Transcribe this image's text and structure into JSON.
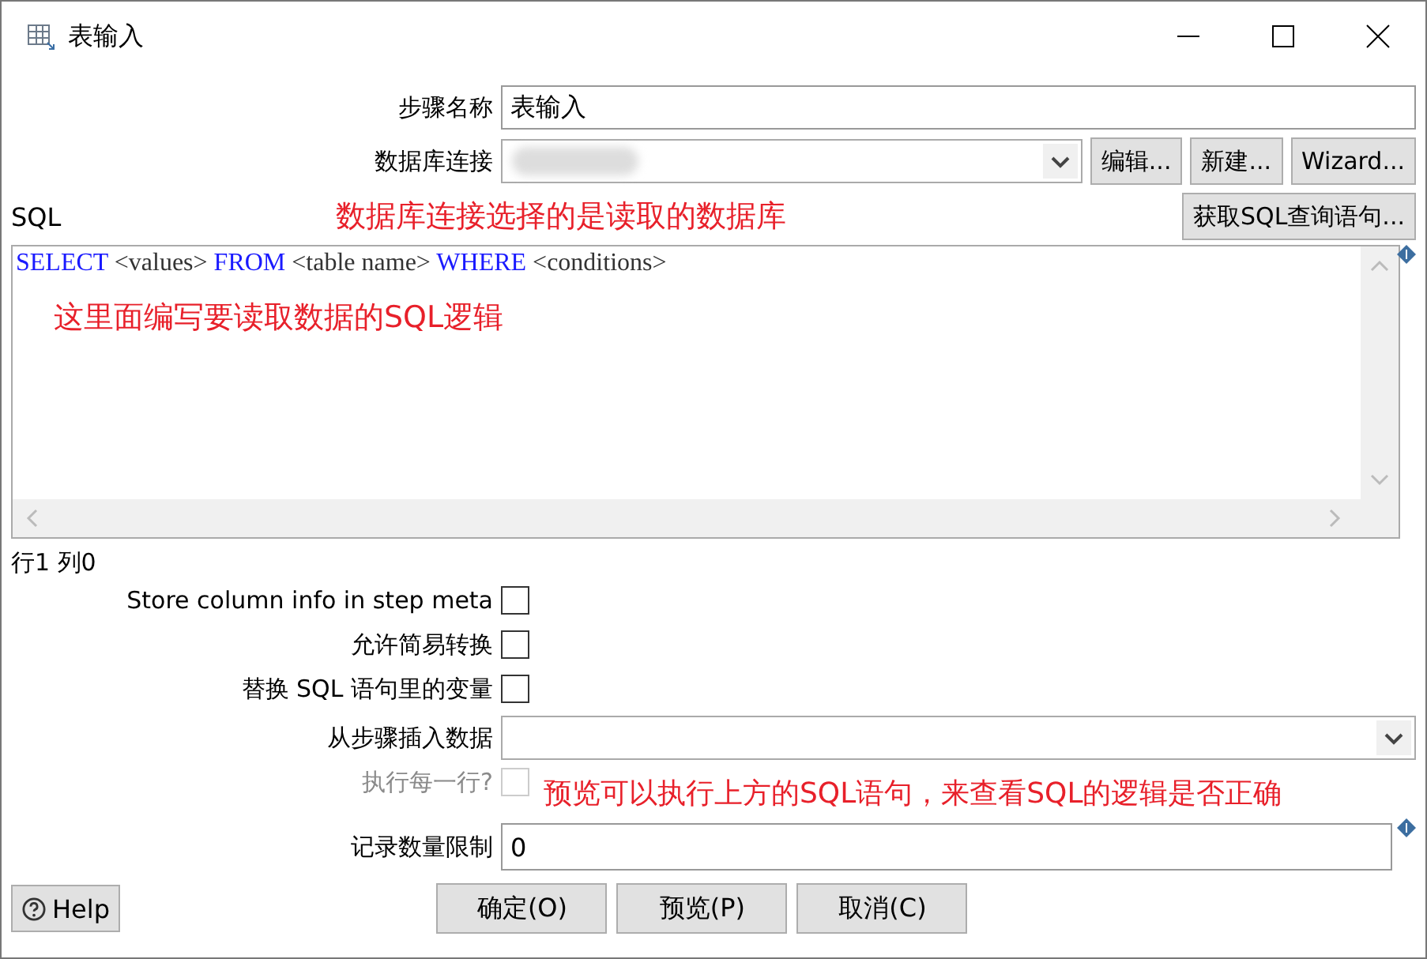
{
  "window": {
    "title": "表输入"
  },
  "step_name": {
    "label": "步骤名称",
    "value": "表输入"
  },
  "connection": {
    "label": "数据库连接",
    "buttons": [
      "编辑...",
      "新建...",
      "Wizard..."
    ]
  },
  "sql_label": "SQL",
  "get_sql_button": "获取SQL查询语句...",
  "sql_tokens": [
    {
      "kind": "keyword",
      "text": "SELECT"
    },
    {
      "kind": "text",
      "text": "<values>"
    },
    {
      "kind": "keyword",
      "text": "FROM"
    },
    {
      "kind": "text",
      "text": "<table name>"
    },
    {
      "kind": "keyword",
      "text": "WHERE"
    },
    {
      "kind": "text",
      "text": "<conditions>"
    }
  ],
  "cursor_position": "行1 列0",
  "options": [
    {
      "label": "Store column info in step meta",
      "checked": false,
      "disabled": false
    },
    {
      "label": "允许简易转换",
      "checked": false,
      "disabled": false
    },
    {
      "label": "替换 SQL 语句里的变量",
      "checked": false,
      "disabled": false
    }
  ],
  "insert_from_step": {
    "label": "从步骤插入数据"
  },
  "execute_each_row": {
    "label": "执行每一行?",
    "checked": false,
    "disabled": true
  },
  "row_limit": {
    "label": "记录数量限制",
    "value": "0"
  },
  "help_button": "Help",
  "buttons": [
    "确定(O)",
    "预览(P)",
    "取消(C)"
  ],
  "annotations": [
    {
      "text": "数据库连接选择的是读取的数据库"
    },
    {
      "text": "这里面编写要读取数据的SQL逻辑"
    },
    {
      "text": "预览可以执行上方的SQL语句，来查看SQL的逻辑是否正确"
    }
  ]
}
